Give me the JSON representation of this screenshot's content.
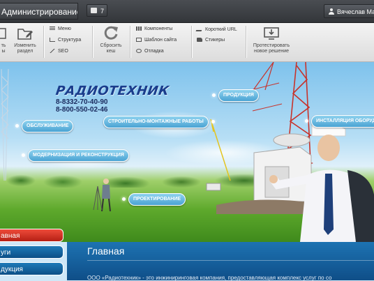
{
  "topbar": {
    "admin_tab": "Администрирование",
    "notifications_count": "7",
    "user_name": "Вячеслав Мас"
  },
  "toolbar": {
    "left_cut_labels": [
      "ть",
      "ы"
    ],
    "change_section": [
      "Изменить",
      "раздел"
    ],
    "group1": [
      "Меню",
      "Структура",
      "SEO"
    ],
    "reset_cache": [
      "Сбросить",
      "кеш"
    ],
    "group2": [
      "Компоненты",
      "Шаблон сайта",
      "Отладка"
    ],
    "group3": [
      "Короткий URL",
      "Стикеры"
    ],
    "test_solution": [
      "Протестировать",
      "новое решение"
    ]
  },
  "hero": {
    "logo": "РАДИОТЕХНИК",
    "phones": [
      "8-8332-70-40-90",
      "8-800-550-02-46"
    ],
    "pills": {
      "service": "Обслуживание",
      "modernization": "Модернизация и реконструкция",
      "construction": "Строительно-монтажные работы",
      "products": "Продукция",
      "installation": "Инсталляция оборудо",
      "design": "Проектирование"
    }
  },
  "nav": {
    "items": [
      {
        "label": "авная",
        "active": true
      },
      {
        "label": "уги",
        "active": false
      },
      {
        "label": "дукция",
        "active": false
      }
    ]
  },
  "content": {
    "title": "Главная",
    "intro": "ООО «Радиотехник» - это инжиниринговая компания, предоставляющая комплекс услуг по со"
  },
  "colors": {
    "accent_red": "#d7311f",
    "accent_blue": "#1565a8",
    "pill_blue": "#4aa3d3"
  }
}
